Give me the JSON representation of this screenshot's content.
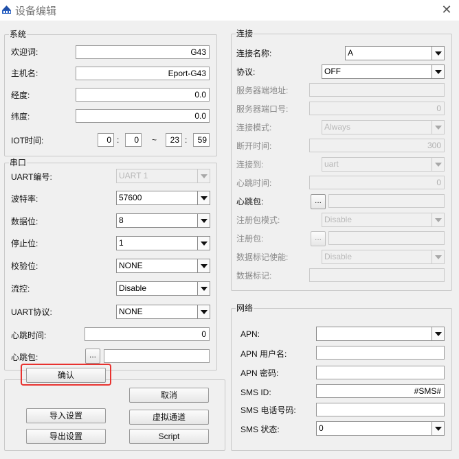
{
  "window": {
    "title": "设备编辑",
    "close_glyph": "✕"
  },
  "system": {
    "legend": "系统",
    "welcome_label": "欢迎词:",
    "welcome_value": "G43",
    "hostname_label": "主机名:",
    "hostname_value": "Eport-G43",
    "longitude_label": "经度:",
    "longitude_value": "0.0",
    "latitude_label": "纬度:",
    "latitude_value": "0.0",
    "iot_time_label": "IOT时间:",
    "iot_start_h": "0",
    "iot_start_m": "0",
    "iot_sep": "~",
    "iot_end_h": "23",
    "iot_end_m": "59",
    "colon": ":"
  },
  "serial": {
    "legend": "串口",
    "uart_no_label": "UART编号:",
    "uart_no_value": "UART 1",
    "baud_label": "波特率:",
    "baud_value": "57600",
    "databits_label": "数据位:",
    "databits_value": "8",
    "stopbits_label": "停止位:",
    "stopbits_value": "1",
    "parity_label": "校验位:",
    "parity_value": "NONE",
    "flow_label": "流控:",
    "flow_value": "Disable",
    "protocol_label": "UART协议:",
    "protocol_value": "NONE",
    "heartbeat_time_label": "心跳时间:",
    "heartbeat_time_value": "0",
    "heartbeat_pkt_label": "心跳包:",
    "heartbeat_pkt_value": "",
    "ellipsis": "..."
  },
  "buttons": {
    "confirm": "确认",
    "cancel": "取消",
    "import": "导入设置",
    "virtual_channel": "虚拟通道",
    "export": "导出设置",
    "script": "Script"
  },
  "connection": {
    "legend": "连接",
    "name_label": "连接名称:",
    "name_value": "A",
    "protocol_label": "协议:",
    "protocol_value": "OFF",
    "server_addr_label": "服务器端地址:",
    "server_addr_value": "",
    "server_port_label": "服务器端口号:",
    "server_port_value": "0",
    "mode_label": "连接模式:",
    "mode_value": "Always",
    "disconnect_label": "断开时间:",
    "disconnect_value": "300",
    "connect_to_label": "连接到:",
    "connect_to_value": "uart",
    "heartbeat_time_label": "心跳时间:",
    "heartbeat_time_value": "0",
    "heartbeat_pkt_label": "心跳包:",
    "heartbeat_pkt_value": "",
    "reg_mode_label": "注册包模式:",
    "reg_mode_value": "Disable",
    "reg_pkt_label": "注册包:",
    "reg_pkt_value": "",
    "data_tag_enable_label": "数据标记使能:",
    "data_tag_enable_value": "Disable",
    "data_tag_label": "数据标记:",
    "data_tag_value": "",
    "ellipsis": "..."
  },
  "network": {
    "legend": "网络",
    "apn_label": "APN:",
    "apn_value": "",
    "apn_user_label": "APN 用户名:",
    "apn_user_value": "",
    "apn_pwd_label": "APN 密码:",
    "apn_pwd_value": "",
    "sms_id_label": "SMS ID:",
    "sms_id_value": "#SMS#",
    "sms_phone_label": "SMS 电话号码:",
    "sms_phone_value": "",
    "sms_state_label": "SMS 状态:",
    "sms_state_value": "0"
  }
}
